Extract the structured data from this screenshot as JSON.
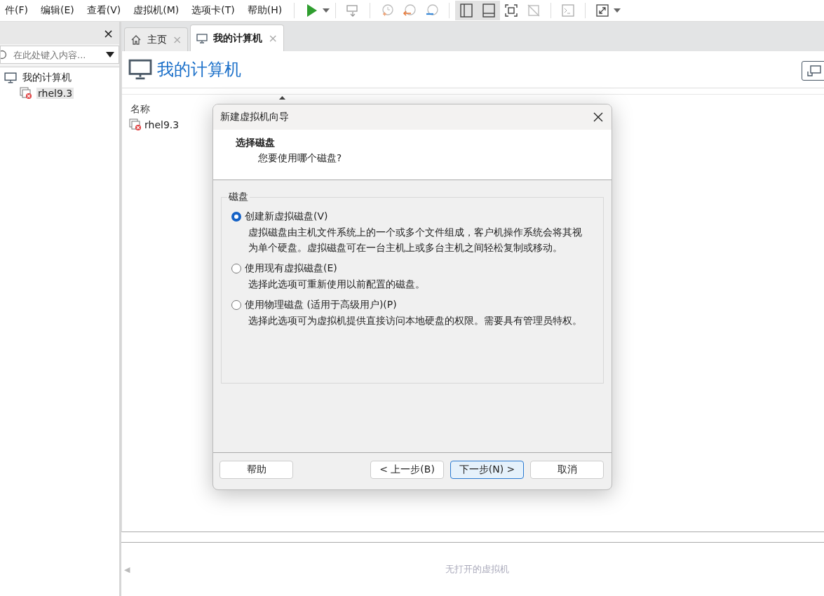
{
  "menu": [
    "件(F)",
    "编辑(E)",
    "查看(V)",
    "虚拟机(M)",
    "选项卡(T)",
    "帮助(H)"
  ],
  "view_buttons": [
    {
      "selected": true
    },
    {
      "selected": true
    },
    {
      "selected": false
    },
    {
      "selected": false
    }
  ],
  "sidebar": {
    "close": "×",
    "search": {
      "placeholder": "在此处键入内容..."
    },
    "tree": [
      {
        "label": "我的计算机",
        "kind": "computer",
        "selected": false,
        "children": [
          {
            "label": "rhel9.3",
            "kind": "vm",
            "selected": true
          }
        ]
      }
    ]
  },
  "tabs": [
    {
      "label": "主页",
      "kind": "home",
      "selected": false,
      "close": "×"
    },
    {
      "label": "我的计算机",
      "kind": "computer",
      "selected": true,
      "close": "×"
    }
  ],
  "page_title": "我的计算机",
  "table": {
    "columns": [
      "名称"
    ],
    "rows": [
      "rhel9.3"
    ]
  },
  "bottom_panel": {
    "left_arrow": "◀",
    "message": "无打开的虚拟机"
  },
  "dialog": {
    "title": "新建虚拟机向导",
    "heading": "选择磁盘",
    "subheading": "您要使用哪个磁盘?",
    "group": "磁盘",
    "options": [
      {
        "label": "创建新虚拟磁盘(V)",
        "description": "虚拟磁盘由主机文件系统上的一个或多个文件组成，客户机操作系统会将其视为单个硬盘。虚拟磁盘可在一台主机上或多台主机之间轻松复制或移动。",
        "selected": true
      },
      {
        "label": "使用现有虚拟磁盘(E)",
        "description": "选择此选项可重新使用以前配置的磁盘。",
        "selected": false
      },
      {
        "label": "使用物理磁盘 (适用于高级用户)(P)",
        "description": "选择此选项可为虚拟机提供直接访问本地硬盘的权限。需要具有管理员特权。",
        "selected": false
      }
    ],
    "buttons": [
      {
        "label": "帮助",
        "kind": "normal"
      },
      {
        "label": "< 上一步(B)",
        "kind": "normal"
      },
      {
        "label": "下一步(N) >",
        "kind": "default"
      },
      {
        "label": "取消",
        "kind": "normal"
      }
    ]
  }
}
